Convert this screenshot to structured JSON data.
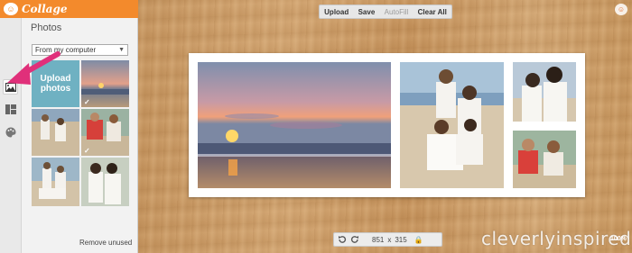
{
  "app": {
    "title": "Collage"
  },
  "sidebar": {
    "panel_title": "Photos",
    "source": {
      "selected": "From my computer"
    },
    "upload_tile_label": "Upload photos",
    "check_mark": "✓",
    "remove_unused": "Remove unused",
    "tools": [
      {
        "name": "photos-tool",
        "icon": "image-icon",
        "active": true
      },
      {
        "name": "layouts-tool",
        "icon": "layout-icon",
        "active": false
      },
      {
        "name": "backgrounds-tool",
        "icon": "palette-icon",
        "active": false
      }
    ]
  },
  "toolbar": {
    "upload": "Upload",
    "save": "Save",
    "autofill": "AutoFill",
    "clear_all": "Clear All"
  },
  "bottom": {
    "width": "851",
    "times": "x",
    "height": "315"
  },
  "watermark": "cleverlyinspired",
  "zoom": "100%",
  "colors": {
    "accent": "#f38a2c",
    "upload_tile": "#6fb1c2",
    "arrow": "#e0307a"
  }
}
